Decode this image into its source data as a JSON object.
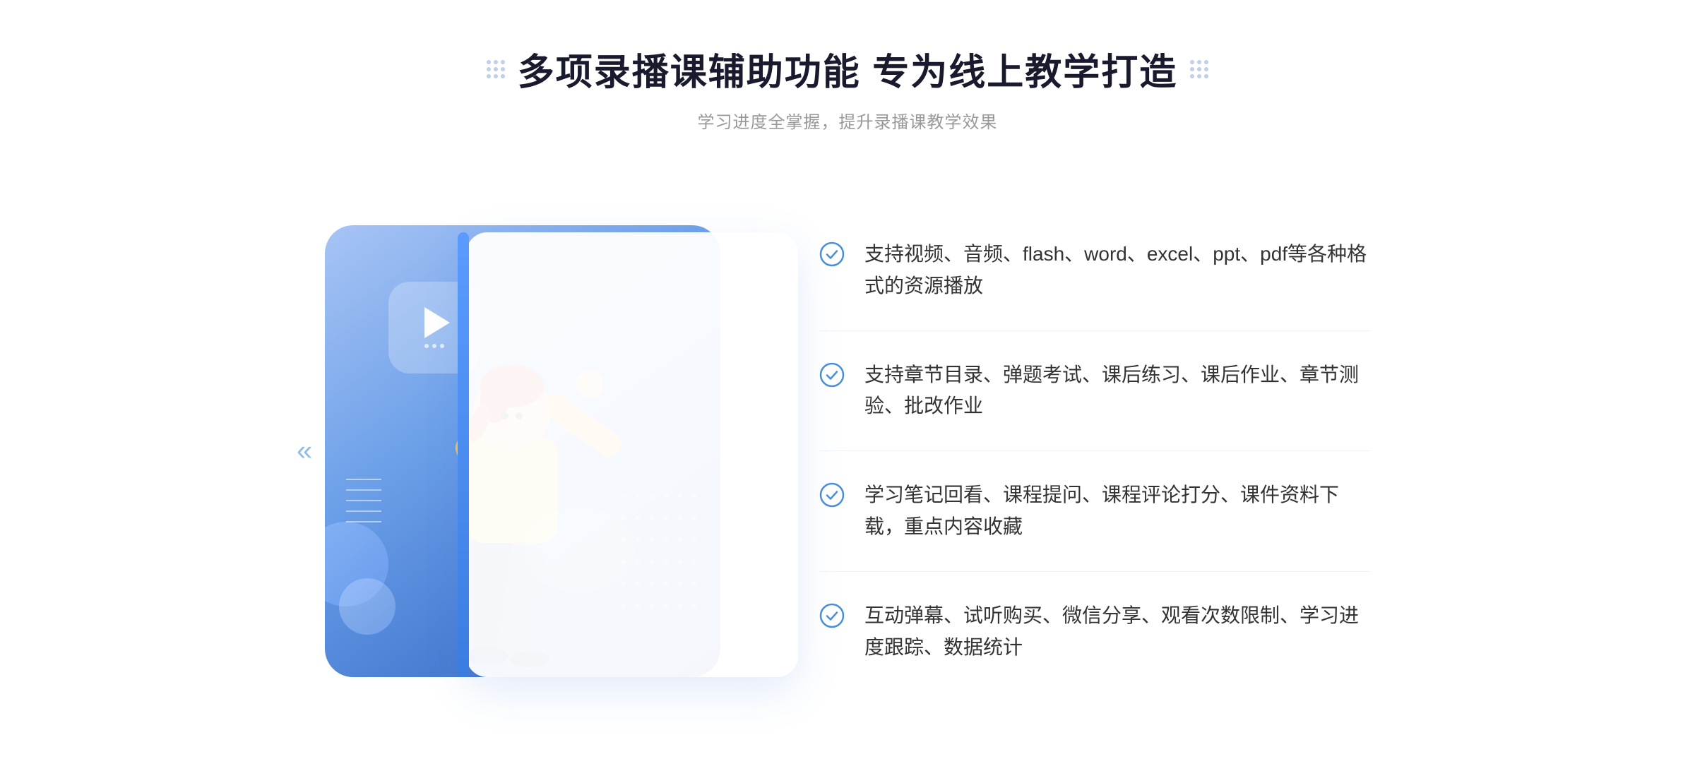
{
  "header": {
    "title": "多项录播课辅助功能 专为线上教学打造",
    "subtitle": "学习进度全掌握，提升录播课教学效果"
  },
  "features": [
    {
      "id": "feature-1",
      "text": "支持视频、音频、flash、word、excel、ppt、pdf等各种格式的资源播放"
    },
    {
      "id": "feature-2",
      "text": "支持章节目录、弹题考试、课后练习、课后作业、章节测验、批改作业"
    },
    {
      "id": "feature-3",
      "text": "学习笔记回看、课程提问、课程评论打分、课件资料下载，重点内容收藏"
    },
    {
      "id": "feature-4",
      "text": "互动弹幕、试听购买、微信分享、观看次数限制、学习进度跟踪、数据统计"
    }
  ],
  "decorative": {
    "left_arrow": "«",
    "play_label": "play-button"
  }
}
